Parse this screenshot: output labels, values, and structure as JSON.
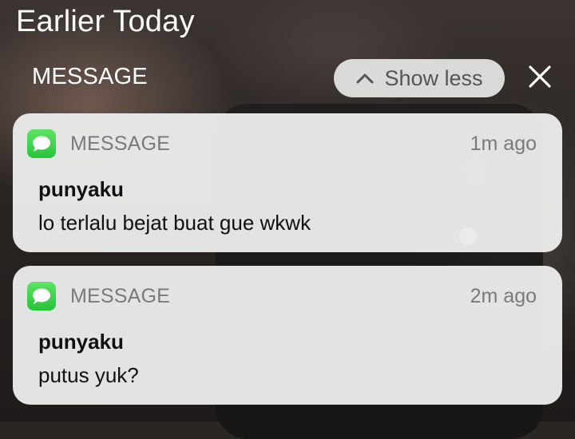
{
  "header": {
    "title": "Earlier Today"
  },
  "group": {
    "label": "MESSAGE",
    "show_less_label": "Show less"
  },
  "notifications": [
    {
      "app": "MESSAGE",
      "time": "1m ago",
      "sender": "punyaku",
      "body": "lo terlalu bejat buat gue wkwk"
    },
    {
      "app": "MESSAGE",
      "time": "2m ago",
      "sender": "punyaku",
      "body": "putus yuk?"
    }
  ],
  "icons": {
    "app_icon": "messages-app-icon",
    "chevron": "chevron-up-icon",
    "close": "close-icon"
  },
  "colors": {
    "messages_green": "#34c759",
    "card_background": "#eeeeee",
    "secondary_text": "#7a7a7a"
  }
}
